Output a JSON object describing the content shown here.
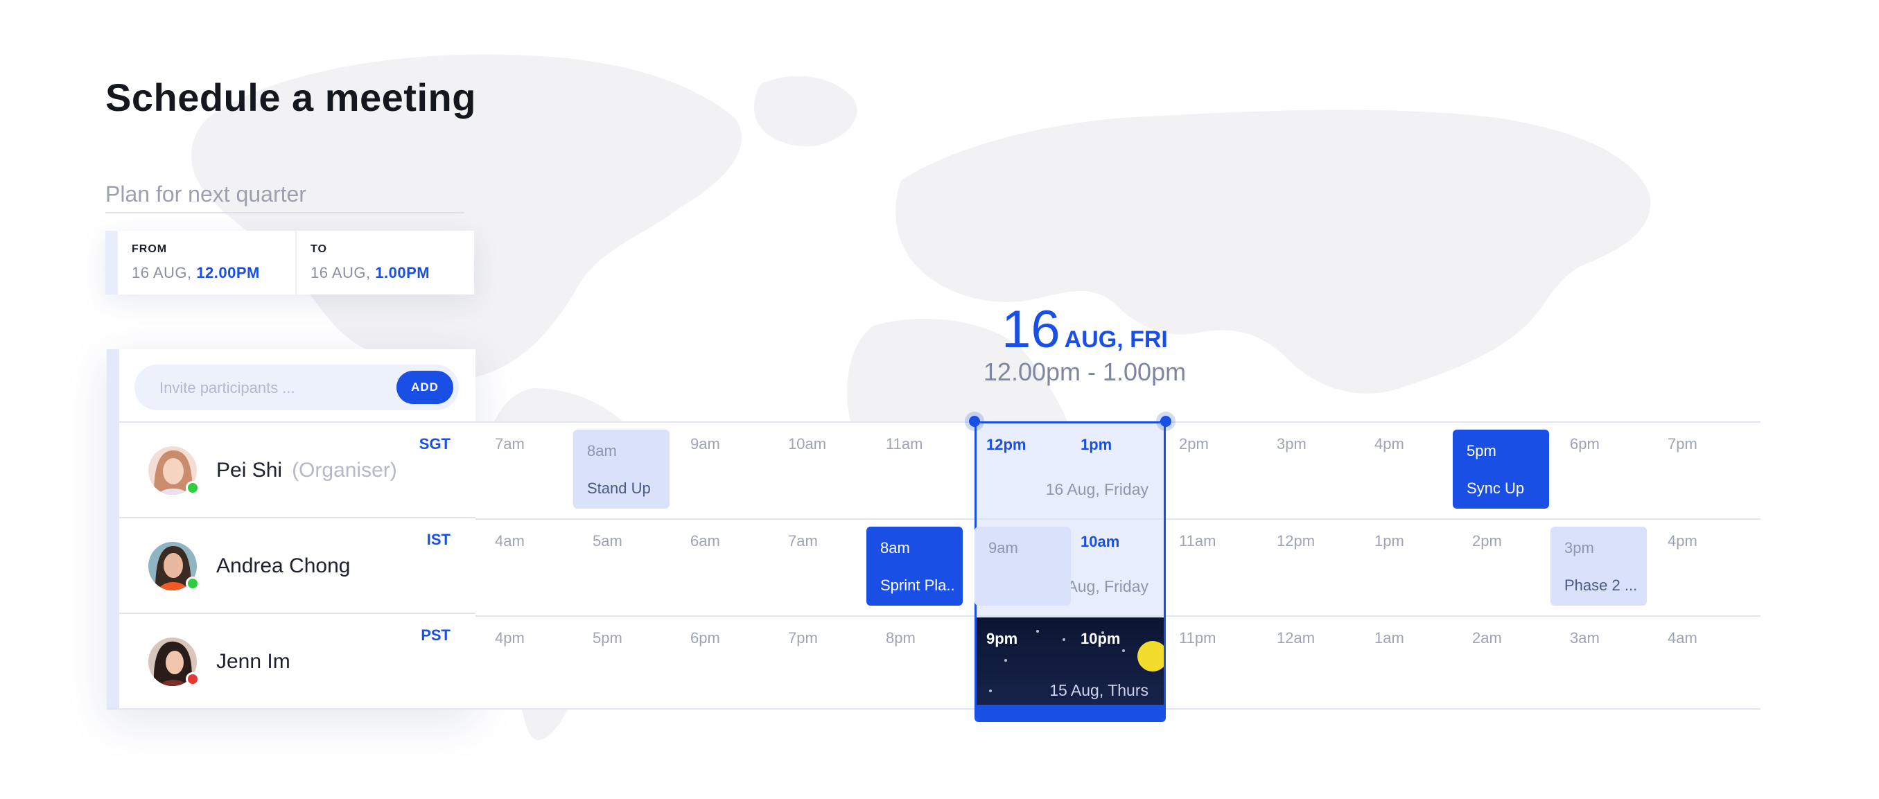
{
  "page": {
    "title": "Schedule a meeting"
  },
  "meeting": {
    "placeholder": "Plan for next quarter"
  },
  "range": {
    "from_label": "FROM",
    "from_date": "16 AUG, ",
    "from_time": "12.00PM",
    "to_label": "TO",
    "to_date": "16 AUG, ",
    "to_time": "1.00PM"
  },
  "selection": {
    "day": "16",
    "month_day": "AUG, FRI",
    "time_range": "12.00pm - 1.00pm"
  },
  "invite": {
    "placeholder": "Invite participants ...",
    "add_label": "ADD"
  },
  "participants": [
    {
      "name": "Pei Shi",
      "role": "(Organiser)",
      "tz": "SGT",
      "status_color": "#2ecc40",
      "hours": [
        "7am",
        "8am",
        "9am",
        "10am",
        "11am",
        "12pm",
        "1pm",
        "2pm",
        "3pm",
        "4pm",
        "5pm",
        "6pm",
        "7pm"
      ],
      "selected_day": "16 Aug, Friday"
    },
    {
      "name": "Andrea Chong",
      "role": "",
      "tz": "IST",
      "status_color": "#2ecc40",
      "hours": [
        "4am",
        "5am",
        "6am",
        "7am",
        "8am",
        "9am",
        "10am",
        "11am",
        "12pm",
        "1pm",
        "2pm",
        "3pm",
        "4pm"
      ],
      "selected_day": "16 Aug, Friday"
    },
    {
      "name": "Jenn Im",
      "role": "",
      "tz": "PST",
      "status_color": "#e53935",
      "hours": [
        "4pm",
        "5pm",
        "6pm",
        "7pm",
        "8pm",
        "9pm",
        "10pm",
        "11pm",
        "12am",
        "1am",
        "2am",
        "3am",
        "4am"
      ],
      "selected_day": "15 Aug, Thurs"
    }
  ],
  "events": [
    {
      "row": 0,
      "hour": "8am",
      "name": "Stand Up",
      "style": "light"
    },
    {
      "row": 0,
      "hour": "5pm",
      "name": "Sync Up",
      "style": "dark"
    },
    {
      "row": 1,
      "hour": "8am",
      "name": "Sprint Pla..",
      "style": "dark"
    },
    {
      "row": 1,
      "hour": "9am",
      "name": "",
      "style": "light"
    },
    {
      "row": 1,
      "hour": "3pm",
      "name": "Phase 2 ...",
      "style": "light"
    }
  ],
  "colors": {
    "accent": "#1a4fe6",
    "online": "#2ecc40",
    "busy": "#e53935"
  }
}
